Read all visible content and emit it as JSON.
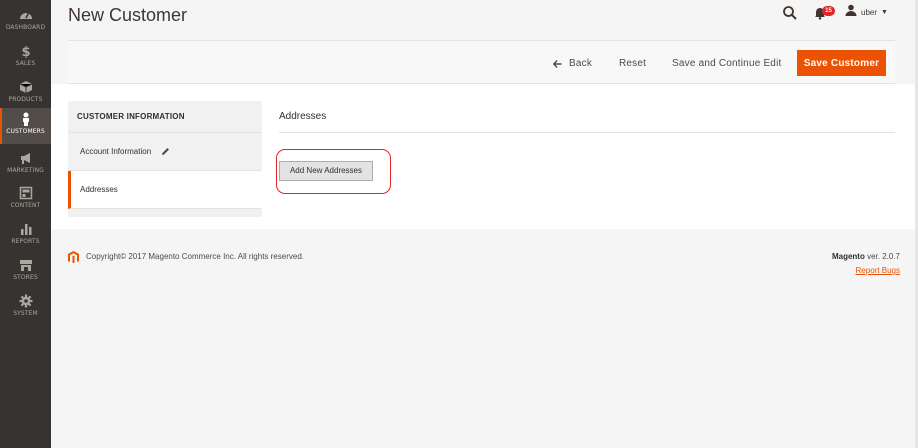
{
  "nav": {
    "items": [
      {
        "label": "DASHBOARD",
        "icon": "speedometer-icon"
      },
      {
        "label": "SALES",
        "icon": "dollar-icon"
      },
      {
        "label": "PRODUCTS",
        "icon": "box-icon"
      },
      {
        "label": "CUSTOMERS",
        "icon": "person-icon"
      },
      {
        "label": "MARKETING",
        "icon": "megaphone-icon"
      },
      {
        "label": "CONTENT",
        "icon": "layout-icon"
      },
      {
        "label": "REPORTS",
        "icon": "bar-chart-icon"
      },
      {
        "label": "STORES",
        "icon": "storefront-icon"
      },
      {
        "label": "SYSTEM",
        "icon": "gear-icon"
      }
    ],
    "active": "CUSTOMERS"
  },
  "header": {
    "title": "New Customer",
    "notification_count": "15",
    "user_name": "uber"
  },
  "actions": {
    "back": "Back",
    "reset": "Reset",
    "save_continue": "Save and Continue Edit",
    "save": "Save Customer"
  },
  "tabs": {
    "title": "CUSTOMER INFORMATION",
    "items": [
      {
        "label": "Account Information"
      },
      {
        "label": "Addresses"
      }
    ],
    "active": "Addresses"
  },
  "section": {
    "title": "Addresses",
    "add_button": "Add New Addresses"
  },
  "footer": {
    "copyright": "Copyright© 2017 Magento Commerce Inc. All rights reserved.",
    "brand": "Magento",
    "version": "ver. 2.0.7",
    "report_bugs": "Report Bugs"
  },
  "colors": {
    "accent": "#eb5202",
    "sidebar": "#373330",
    "highlight": "#e22626"
  }
}
